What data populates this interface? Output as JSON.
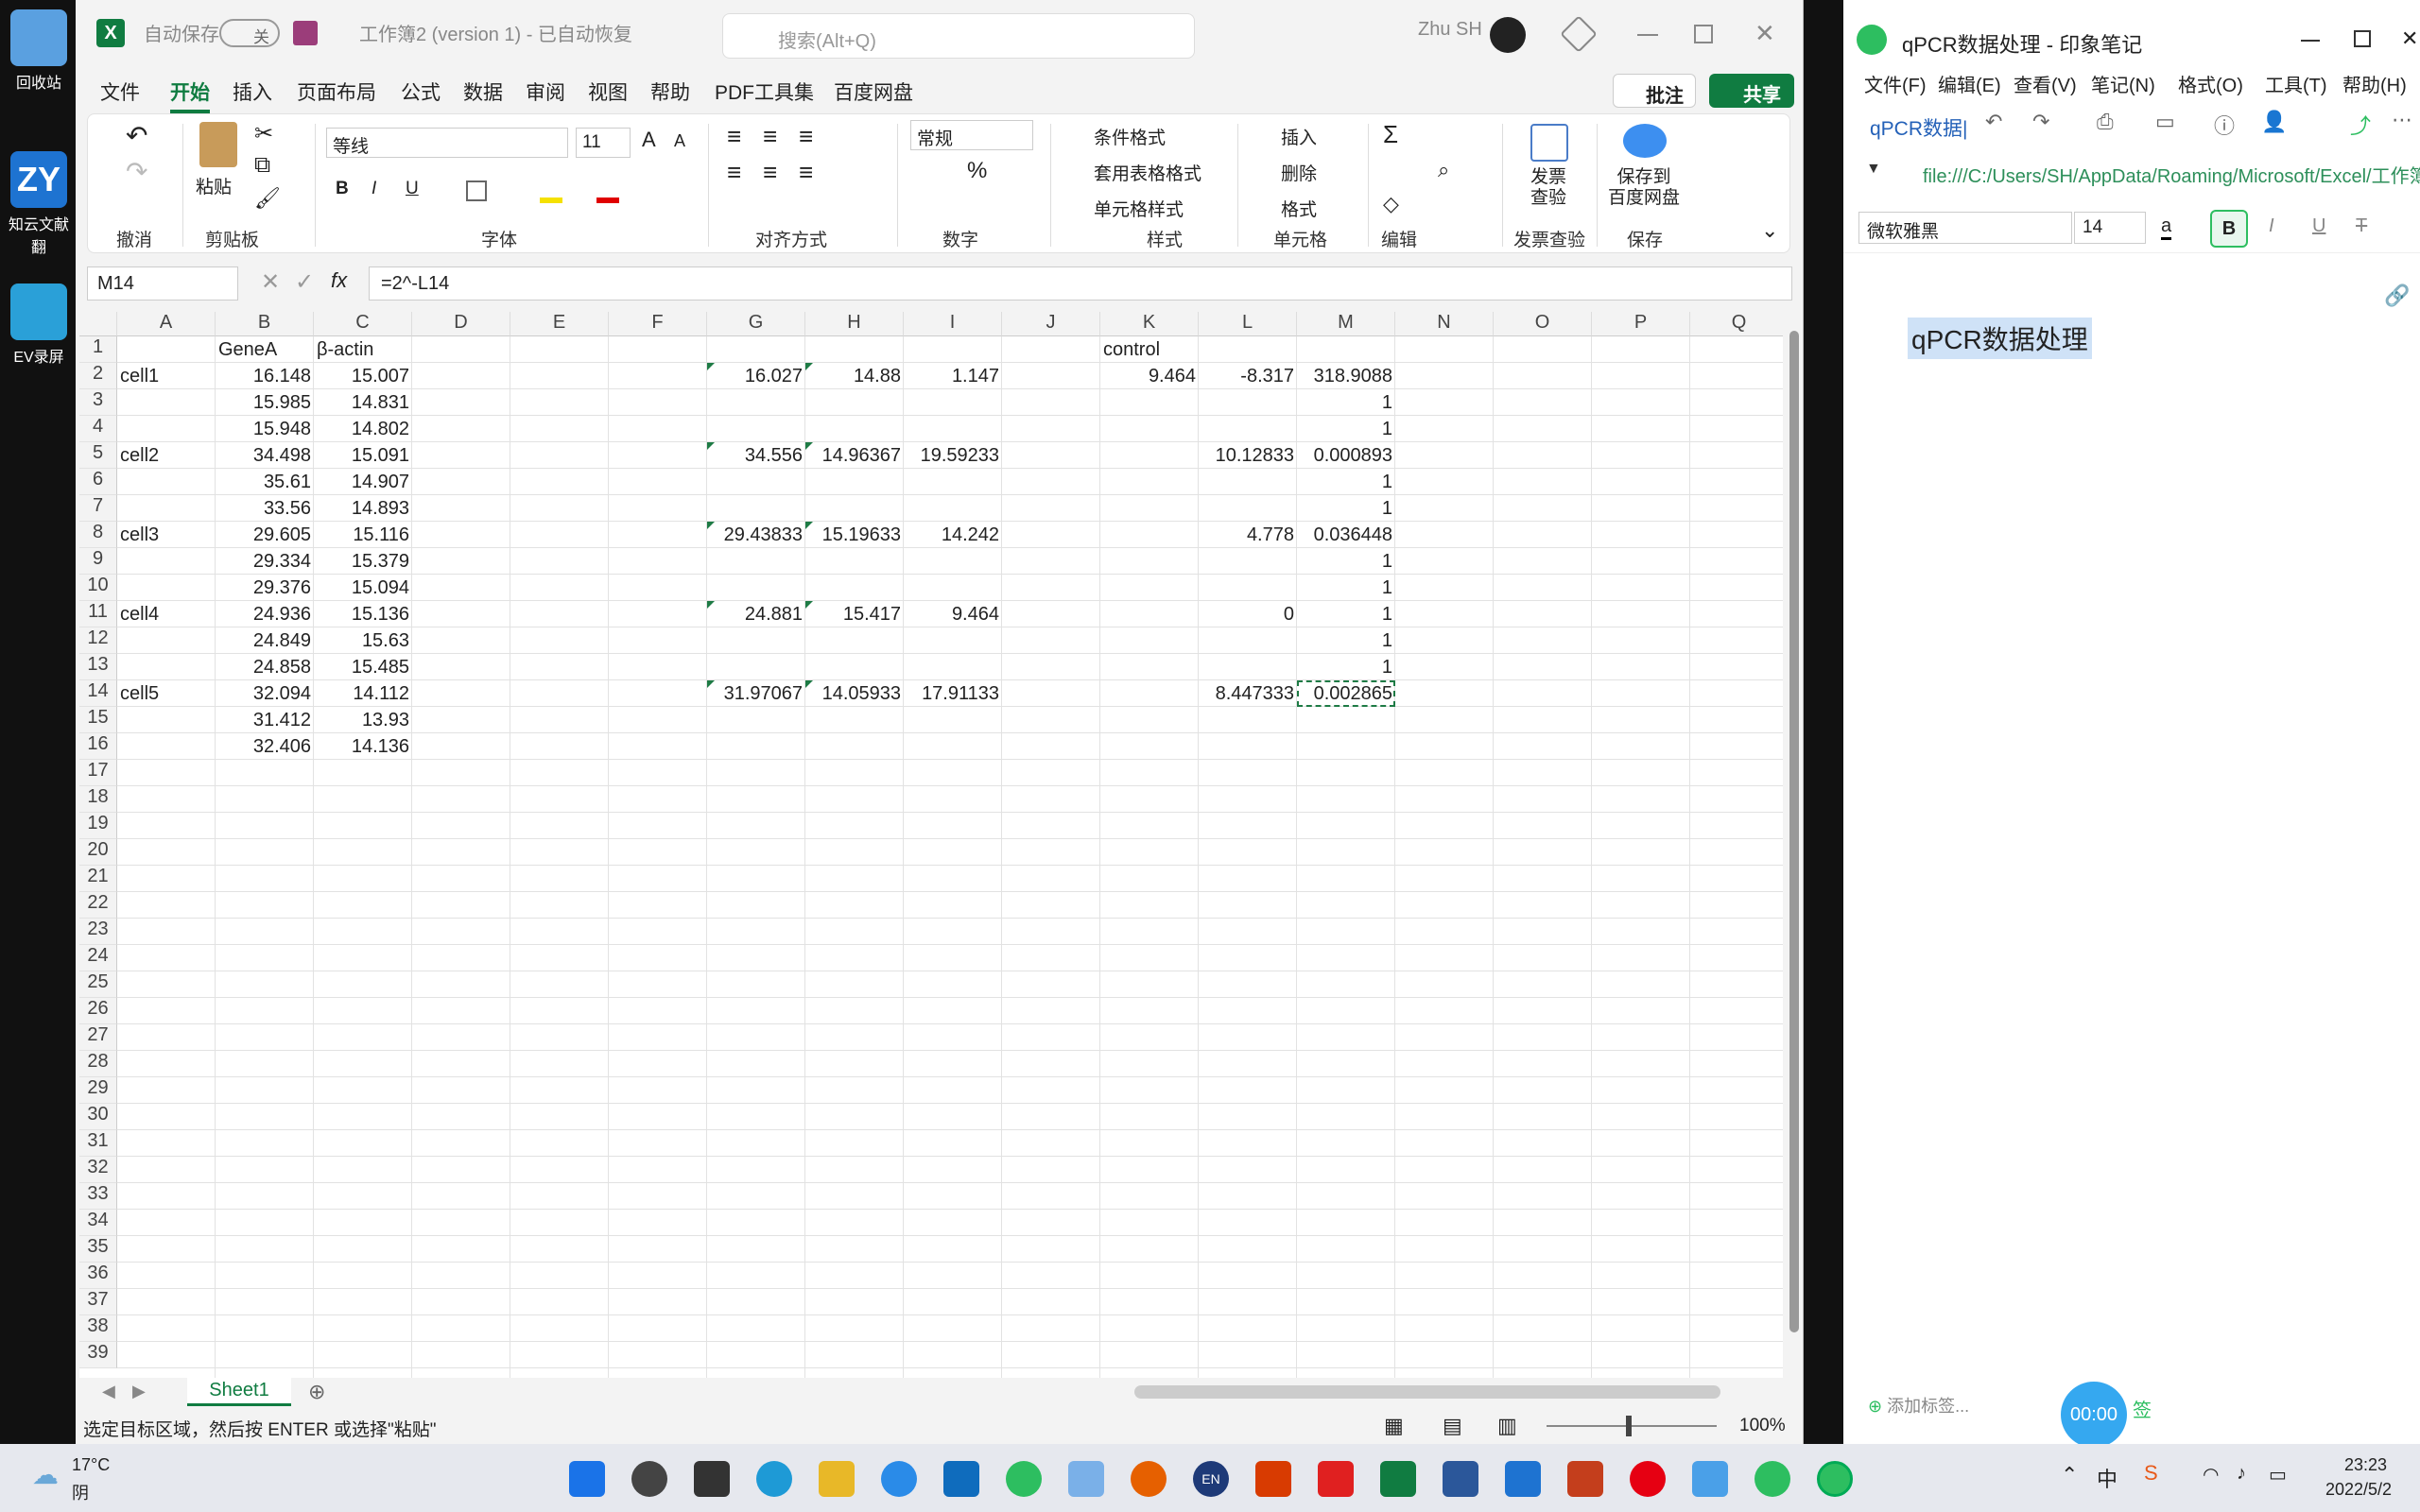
{
  "desktop": {
    "icons": [
      {
        "label": "回收站",
        "color": "#5aa0e0"
      },
      {
        "label": "知云文献翻",
        "color": "#1e73d1"
      },
      {
        "label": "EV录屏",
        "color": "#2aa0d8"
      }
    ]
  },
  "excel": {
    "app_icon": "X",
    "autosave_label": "自动保存",
    "autosave_state": "关",
    "doc_title": "工作簿2 (version 1) - 已自动恢复",
    "search_placeholder": "搜索(Alt+Q)",
    "user_name": "Zhu SH",
    "menus": [
      "文件",
      "开始",
      "插入",
      "页面布局",
      "公式",
      "数据",
      "审阅",
      "视图",
      "帮助",
      "PDF工具集",
      "百度网盘"
    ],
    "active_menu": "开始",
    "comment_btn": "批注",
    "share_btn": "共享",
    "ribbon": {
      "groups": [
        "撤消",
        "剪贴板",
        "字体",
        "对齐方式",
        "数字",
        "样式",
        "单元格",
        "编辑",
        "发票查验",
        "保存"
      ],
      "paste": "粘贴",
      "font_name": "等线",
      "font_size": "11",
      "number_format": "常规",
      "cond_format": "条件格式",
      "table_format": "套用表格格式",
      "cell_style": "单元格样式",
      "insert": "插入",
      "delete": "删除",
      "format": "格式",
      "invoice": "发票\n查验",
      "save_baidu": "保存到\n百度网盘",
      "bold": "B",
      "italic": "I",
      "underline": "U"
    },
    "name_box": "M14",
    "formula": "=2^-L14",
    "columns": [
      "A",
      "B",
      "C",
      "D",
      "E",
      "F",
      "G",
      "H",
      "I",
      "J",
      "K",
      "L",
      "M",
      "N",
      "O",
      "P",
      "Q"
    ],
    "rows": [
      "1",
      "2",
      "3",
      "4",
      "5",
      "6",
      "7",
      "8",
      "9",
      "10",
      "11",
      "12",
      "13",
      "14",
      "15",
      "16",
      "17",
      "18",
      "19",
      "20",
      "21",
      "22",
      "23",
      "24",
      "25",
      "26",
      "27",
      "28",
      "29",
      "30",
      "31",
      "32",
      "33",
      "34",
      "35",
      "36",
      "37",
      "38",
      "39"
    ],
    "cells": [
      {
        "c": "B",
        "r": 1,
        "v": "GeneA",
        "t": "text"
      },
      {
        "c": "C",
        "r": 1,
        "v": "β-actin",
        "t": "text"
      },
      {
        "c": "K",
        "r": 1,
        "v": "control",
        "t": "text"
      },
      {
        "c": "A",
        "r": 2,
        "v": "cell1",
        "t": "text"
      },
      {
        "c": "B",
        "r": 2,
        "v": "16.148"
      },
      {
        "c": "C",
        "r": 2,
        "v": "15.007"
      },
      {
        "c": "G",
        "r": 2,
        "v": "16.027",
        "f": 1
      },
      {
        "c": "H",
        "r": 2,
        "v": "14.88",
        "f": 1
      },
      {
        "c": "I",
        "r": 2,
        "v": "1.147"
      },
      {
        "c": "K",
        "r": 2,
        "v": "9.464"
      },
      {
        "c": "L",
        "r": 2,
        "v": "-8.317"
      },
      {
        "c": "M",
        "r": 2,
        "v": "318.9088"
      },
      {
        "c": "B",
        "r": 3,
        "v": "15.985"
      },
      {
        "c": "C",
        "r": 3,
        "v": "14.831"
      },
      {
        "c": "M",
        "r": 3,
        "v": "1"
      },
      {
        "c": "B",
        "r": 4,
        "v": "15.948"
      },
      {
        "c": "C",
        "r": 4,
        "v": "14.802"
      },
      {
        "c": "M",
        "r": 4,
        "v": "1"
      },
      {
        "c": "A",
        "r": 5,
        "v": "cell2",
        "t": "text"
      },
      {
        "c": "B",
        "r": 5,
        "v": "34.498"
      },
      {
        "c": "C",
        "r": 5,
        "v": "15.091"
      },
      {
        "c": "G",
        "r": 5,
        "v": "34.556",
        "f": 1
      },
      {
        "c": "H",
        "r": 5,
        "v": "14.96367",
        "f": 1
      },
      {
        "c": "I",
        "r": 5,
        "v": "19.59233"
      },
      {
        "c": "L",
        "r": 5,
        "v": "10.12833"
      },
      {
        "c": "M",
        "r": 5,
        "v": "0.000893"
      },
      {
        "c": "B",
        "r": 6,
        "v": "35.61"
      },
      {
        "c": "C",
        "r": 6,
        "v": "14.907"
      },
      {
        "c": "M",
        "r": 6,
        "v": "1"
      },
      {
        "c": "B",
        "r": 7,
        "v": "33.56"
      },
      {
        "c": "C",
        "r": 7,
        "v": "14.893"
      },
      {
        "c": "M",
        "r": 7,
        "v": "1"
      },
      {
        "c": "A",
        "r": 8,
        "v": "cell3",
        "t": "text"
      },
      {
        "c": "B",
        "r": 8,
        "v": "29.605"
      },
      {
        "c": "C",
        "r": 8,
        "v": "15.116"
      },
      {
        "c": "G",
        "r": 8,
        "v": "29.43833",
        "f": 1
      },
      {
        "c": "H",
        "r": 8,
        "v": "15.19633",
        "f": 1
      },
      {
        "c": "I",
        "r": 8,
        "v": "14.242"
      },
      {
        "c": "L",
        "r": 8,
        "v": "4.778"
      },
      {
        "c": "M",
        "r": 8,
        "v": "0.036448"
      },
      {
        "c": "B",
        "r": 9,
        "v": "29.334"
      },
      {
        "c": "C",
        "r": 9,
        "v": "15.379"
      },
      {
        "c": "M",
        "r": 9,
        "v": "1"
      },
      {
        "c": "B",
        "r": 10,
        "v": "29.376"
      },
      {
        "c": "C",
        "r": 10,
        "v": "15.094"
      },
      {
        "c": "M",
        "r": 10,
        "v": "1"
      },
      {
        "c": "A",
        "r": 11,
        "v": "cell4",
        "t": "text"
      },
      {
        "c": "B",
        "r": 11,
        "v": "24.936"
      },
      {
        "c": "C",
        "r": 11,
        "v": "15.136"
      },
      {
        "c": "G",
        "r": 11,
        "v": "24.881",
        "f": 1
      },
      {
        "c": "H",
        "r": 11,
        "v": "15.417",
        "f": 1
      },
      {
        "c": "I",
        "r": 11,
        "v": "9.464"
      },
      {
        "c": "L",
        "r": 11,
        "v": "0"
      },
      {
        "c": "M",
        "r": 11,
        "v": "1"
      },
      {
        "c": "B",
        "r": 12,
        "v": "24.849"
      },
      {
        "c": "C",
        "r": 12,
        "v": "15.63"
      },
      {
        "c": "M",
        "r": 12,
        "v": "1"
      },
      {
        "c": "B",
        "r": 13,
        "v": "24.858"
      },
      {
        "c": "C",
        "r": 13,
        "v": "15.485"
      },
      {
        "c": "M",
        "r": 13,
        "v": "1"
      },
      {
        "c": "A",
        "r": 14,
        "v": "cell5",
        "t": "text"
      },
      {
        "c": "B",
        "r": 14,
        "v": "32.094"
      },
      {
        "c": "C",
        "r": 14,
        "v": "14.112"
      },
      {
        "c": "G",
        "r": 14,
        "v": "31.97067",
        "f": 1
      },
      {
        "c": "H",
        "r": 14,
        "v": "14.05933",
        "f": 1
      },
      {
        "c": "I",
        "r": 14,
        "v": "17.91133"
      },
      {
        "c": "L",
        "r": 14,
        "v": "8.447333"
      },
      {
        "c": "M",
        "r": 14,
        "v": "0.002865"
      },
      {
        "c": "B",
        "r": 15,
        "v": "31.412"
      },
      {
        "c": "C",
        "r": 15,
        "v": "13.93"
      },
      {
        "c": "B",
        "r": 16,
        "v": "32.406"
      },
      {
        "c": "C",
        "r": 16,
        "v": "14.136"
      }
    ],
    "selected_cell": "M14",
    "sheet_tab": "Sheet1",
    "status_text": "选定目标区域，然后按 ENTER 或选择\"粘贴\"",
    "zoom": "100%"
  },
  "evernote": {
    "title": "qPCR数据处理 - 印象笔记",
    "menus": [
      "文件(F)",
      "编辑(E)",
      "查看(V)",
      "笔记(N)",
      "格式(O)",
      "工具(T)",
      "帮助(H)"
    ],
    "breadcrumb": "qPCR数据|",
    "url": "file:///C:/Users/SH/AppData/Roaming/Microsoft/Excel/工作簿",
    "font": "微软雅黑",
    "size": "14",
    "color_label": "a",
    "note_body": "qPCR数据处理",
    "add_tag": "添加标签...",
    "timer": "00:00",
    "tag_label": "签"
  },
  "taskbar": {
    "weather_temp": "17°C",
    "weather_desc": "阴",
    "time": "23:23",
    "date": "2022/5/2",
    "ime": "中",
    "lang_badge": "EN"
  }
}
